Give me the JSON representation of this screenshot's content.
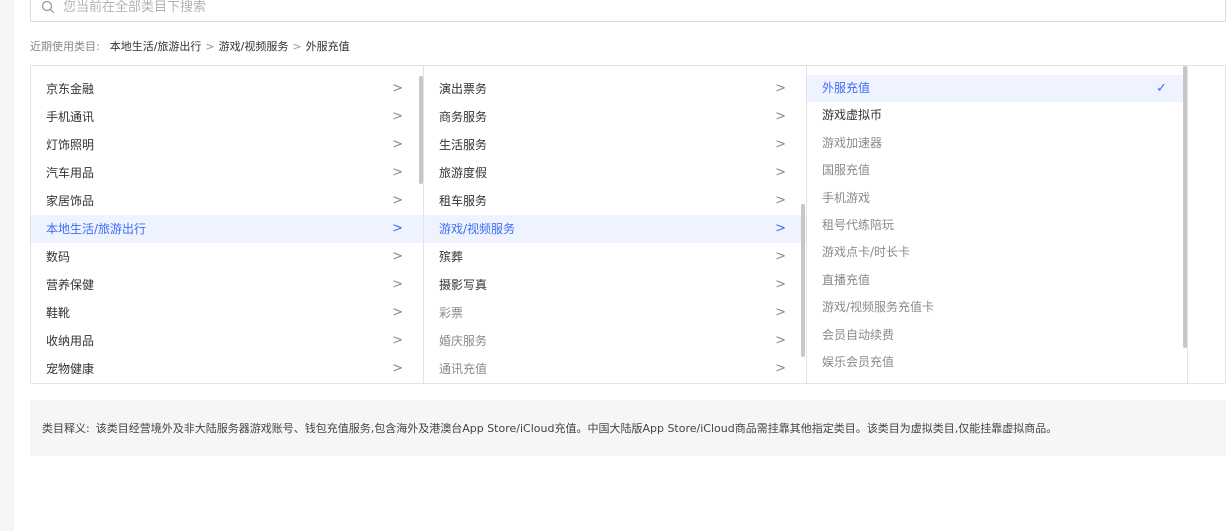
{
  "search": {
    "placeholder": "您当前在全部类目下搜索",
    "value": ""
  },
  "recent": {
    "label": "近期使用类目:",
    "path": [
      "本地生活/旅游出行",
      "游戏/视频服务",
      "外服充值"
    ],
    "separator": ">"
  },
  "column1": {
    "items": [
      {
        "label": "京东金融",
        "arrow": ">"
      },
      {
        "label": "手机通讯",
        "arrow": ">"
      },
      {
        "label": "灯饰照明",
        "arrow": ">"
      },
      {
        "label": "汽车用品",
        "arrow": ">"
      },
      {
        "label": "家居饰品",
        "arrow": ">"
      },
      {
        "label": "本地生活/旅游出行",
        "arrow": ">"
      },
      {
        "label": "数码",
        "arrow": ">"
      },
      {
        "label": "营养保健",
        "arrow": ">"
      },
      {
        "label": "鞋靴",
        "arrow": ">"
      },
      {
        "label": "收纳用品",
        "arrow": ">"
      },
      {
        "label": "宠物健康",
        "arrow": ">"
      }
    ],
    "active_index": 5
  },
  "column2": {
    "items": [
      {
        "label": "演出票务",
        "arrow": ">"
      },
      {
        "label": "商务服务",
        "arrow": ">"
      },
      {
        "label": "生活服务",
        "arrow": ">"
      },
      {
        "label": "旅游度假",
        "arrow": ">"
      },
      {
        "label": "租车服务",
        "arrow": ">"
      },
      {
        "label": "游戏/视频服务",
        "arrow": ">"
      },
      {
        "label": "殡葬",
        "arrow": ">"
      },
      {
        "label": "摄影写真",
        "arrow": ">"
      },
      {
        "label": "彩票",
        "arrow": ">"
      },
      {
        "label": "婚庆服务",
        "arrow": ">"
      },
      {
        "label": "通讯充值",
        "arrow": ">"
      }
    ],
    "active_index": 5
  },
  "column3": {
    "items": [
      {
        "label": "外服充值"
      },
      {
        "label": "游戏虚拟币"
      },
      {
        "label": "游戏加速器"
      },
      {
        "label": "国服充值"
      },
      {
        "label": "手机游戏"
      },
      {
        "label": "租号代练陪玩"
      },
      {
        "label": "游戏点卡/时长卡"
      },
      {
        "label": "直播充值"
      },
      {
        "label": "游戏/视频服务充值卡"
      },
      {
        "label": "会员自动续费"
      },
      {
        "label": "娱乐会员充值"
      }
    ],
    "selected_index": 0,
    "check": "✓"
  },
  "description": {
    "label": "类目释义:",
    "text": "该类目经营境外及非大陆服务器游戏账号、钱包充值服务,包含海外及港澳台App Store/iCloud充值。中国大陆版App Store/iCloud商品需挂靠其他指定类目。该类目为虚拟类目,仅能挂靠虚拟商品。"
  },
  "colors": {
    "accent": "#3d6df5",
    "active_bg": "#eef3ff",
    "border": "#e3e3e3",
    "muted": "#8a8a8a"
  }
}
